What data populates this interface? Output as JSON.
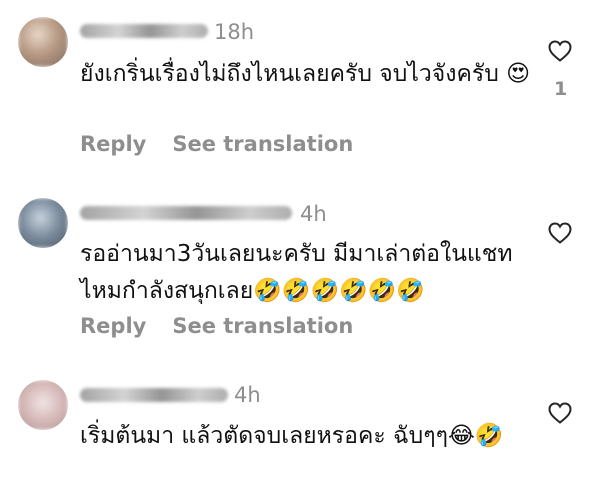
{
  "comments": [
    {
      "time": "18h",
      "text": "ยังเกริ่นเรื่องไม่ถึงไหนเลยครับ จบไวจังครับ 😍",
      "likes": "1",
      "reply_label": "Reply",
      "translate_label": "See translation"
    },
    {
      "time": "4h",
      "text": "รออ่านมา3วันเลยนะครับ มีมาเล่าต่อในแชทไหมกำลังสนุกเลย🤣🤣🤣🤣🤣🤣",
      "reply_label": "Reply",
      "translate_label": "See translation"
    },
    {
      "time": "4h",
      "text": "เริ่มต้นมา แล้วตัดจบเลยหรอคะ ฉับๆๆ😂🤣"
    }
  ],
  "colors": {
    "secondary_text": "#8e8e8e",
    "primary_text": "#111111",
    "background": "#ffffff"
  },
  "icons": [
    "heart-outline-icon"
  ]
}
